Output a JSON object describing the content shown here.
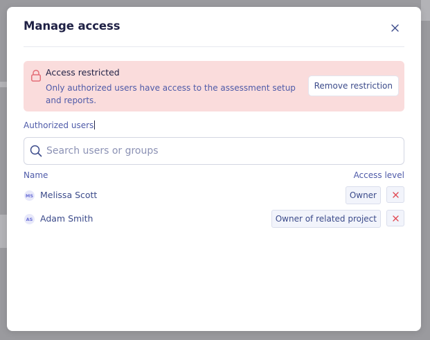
{
  "modal": {
    "title": "Manage access",
    "close_icon": "close-icon"
  },
  "alert": {
    "icon": "lock-icon",
    "title": "Access restricted",
    "body": "Only authorized users have access to the assessment setup and reports.",
    "button_label": "Remove restriction"
  },
  "authorized_users": {
    "label": "Authorized users",
    "search_placeholder": "Search users or groups",
    "search_value": "",
    "columns": {
      "name": "Name",
      "access_level": "Access level"
    },
    "users": [
      {
        "initials": "MS",
        "name": "Melissa Scott",
        "access": "Owner"
      },
      {
        "initials": "AS",
        "name": "Adam Smith",
        "access": "Owner of related project"
      }
    ]
  },
  "colors": {
    "title": "#1f2145",
    "accent_text": "#4e5aa8",
    "alert_background": "#fadcdc",
    "alert_icon": "#e36d76",
    "remove_icon": "#e0454f"
  }
}
